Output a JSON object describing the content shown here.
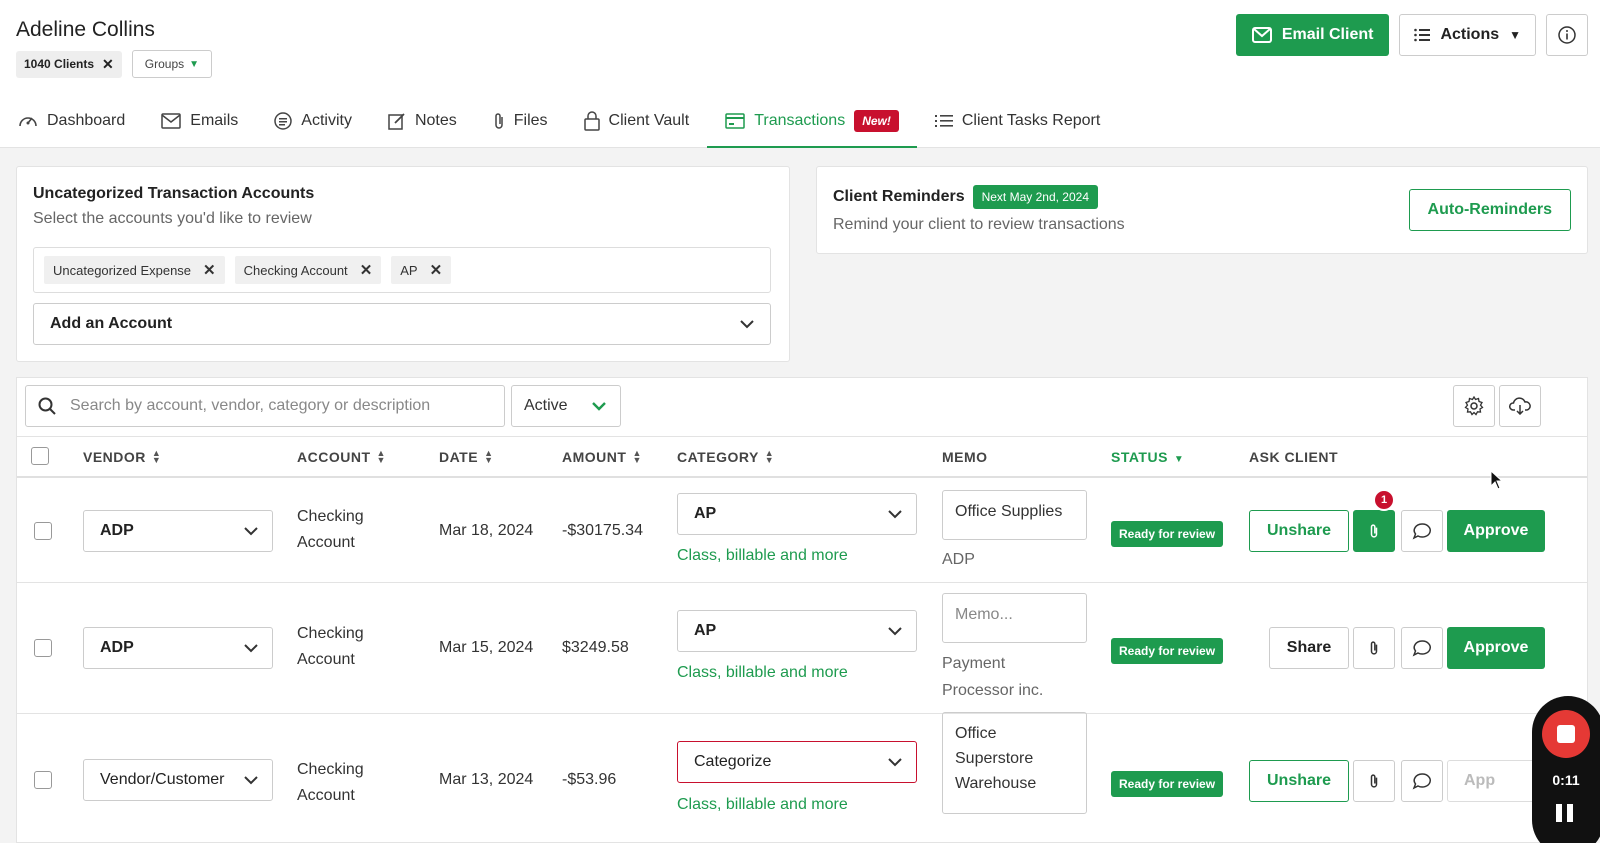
{
  "header": {
    "client_name": "Adeline Collins",
    "client_tag": "1040 Clients",
    "groups_label": "Groups",
    "email_client_label": "Email Client",
    "actions_label": "Actions"
  },
  "tabs": [
    {
      "label": "Dashboard",
      "icon": "dashboard-icon"
    },
    {
      "label": "Emails",
      "icon": "envelope-icon"
    },
    {
      "label": "Activity",
      "icon": "activity-icon"
    },
    {
      "label": "Notes",
      "icon": "notes-icon"
    },
    {
      "label": "Files",
      "icon": "paperclip-icon"
    },
    {
      "label": "Client Vault",
      "icon": "lock-icon"
    },
    {
      "label": "Transactions",
      "icon": "card-icon",
      "badge": "New!",
      "active": true
    },
    {
      "label": "Client Tasks Report",
      "icon": "list-icon"
    }
  ],
  "accounts_card": {
    "title": "Uncategorized Transaction Accounts",
    "subtitle": "Select the accounts you'd like to review",
    "chips": [
      "Uncategorized Expense",
      "Checking Account",
      "AP"
    ],
    "add_account_label": "Add an Account"
  },
  "reminders_card": {
    "title": "Client Reminders",
    "next_badge": "Next May 2nd, 2024",
    "subtitle": "Remind your client to review transactions",
    "auto_reminders_label": "Auto-Reminders"
  },
  "table": {
    "search_placeholder": "Search by account, vendor, category or description",
    "status_filter": "Active",
    "columns": {
      "vendor": "VENDOR",
      "account": "ACCOUNT",
      "date": "DATE",
      "amount": "AMOUNT",
      "category": "CATEGORY",
      "memo": "MEMO",
      "status": "STATUS",
      "ask_client": "ASK CLIENT"
    },
    "rows": [
      {
        "vendor": "ADP",
        "account_line1": "Checking",
        "account_line2": "Account",
        "date": "Mar 18, 2024",
        "amount": "-$30175.34",
        "category": "AP",
        "category_link": "Class, billable and more",
        "memo": "Office  Supplies",
        "memo_under": "ADP",
        "status": "Ready for review",
        "share_label": "Unshare",
        "attachments": "1",
        "approve_label": "Approve"
      },
      {
        "vendor": "ADP",
        "account_line1": "Checking",
        "account_line2": "Account",
        "date": "Mar 15, 2024",
        "amount": "$3249.58",
        "category": "AP",
        "category_link": "Class, billable and more",
        "memo_placeholder": "Memo...",
        "memo_under_line1": "Payment",
        "memo_under_line2": "Processor inc.",
        "status": "Ready for review",
        "share_label": "Share",
        "approve_label": "Approve"
      },
      {
        "vendor": "Vendor/Customer",
        "account_line1": "Checking",
        "account_line2": "Account",
        "date": "Mar 13, 2024",
        "amount": "-$53.96",
        "category": "Categorize",
        "category_link": "Class, billable and more",
        "memo_line1": "Office",
        "memo_line2": "Superstore",
        "memo_line3": "Warehouse",
        "status": "Ready for review",
        "share_label": "Unshare",
        "approve_label": "App"
      }
    ]
  },
  "recorder": {
    "time": "0:11"
  },
  "colors": {
    "brand_green": "#1e9b4f",
    "alert_red": "#c8102e"
  }
}
